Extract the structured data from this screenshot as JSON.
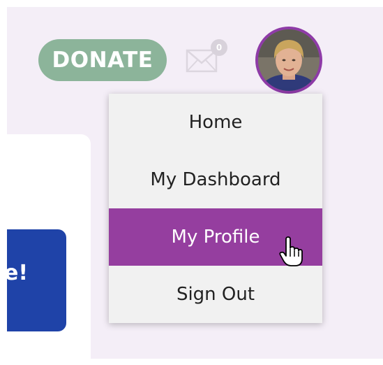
{
  "header": {
    "donate_label": "DONATE",
    "mail_count": "0",
    "mail_icon": "envelope-icon",
    "avatar_icon": "user-avatar-photo"
  },
  "side_card": {
    "cta_text": "e!"
  },
  "user_menu": {
    "items": [
      {
        "label": "Home",
        "active": false
      },
      {
        "label": "My Dashboard",
        "active": false
      },
      {
        "label": "My Profile",
        "active": true
      },
      {
        "label": "Sign Out",
        "active": false
      }
    ]
  },
  "colors": {
    "donate": "#8cb49a",
    "accent_purple": "#953e9f",
    "cta_blue": "#1f43a8",
    "background": "#f4eef7"
  }
}
